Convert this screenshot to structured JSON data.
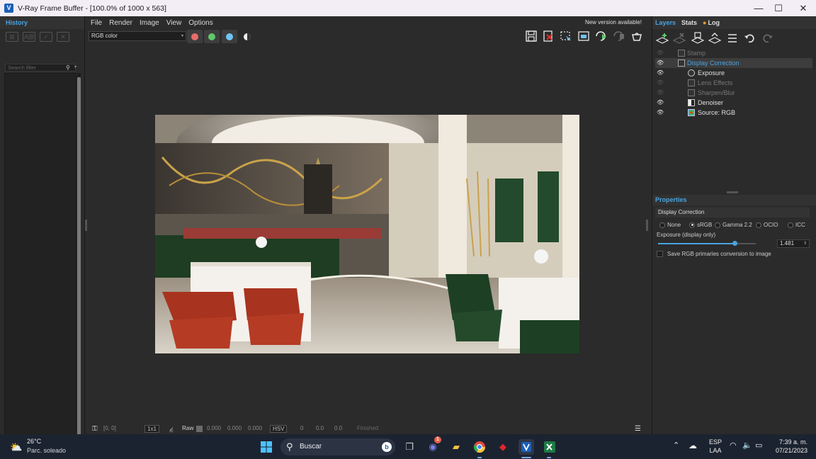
{
  "window": {
    "app_icon": "V",
    "title": "V-Ray Frame Buffer - [100.0% of 1000 x 563]",
    "controls": {
      "minimize": "—",
      "maximize": "☐",
      "close": "✕"
    }
  },
  "history": {
    "header": "History",
    "tools": [
      "⊞",
      "A|B",
      "✓",
      "✕"
    ],
    "search_placeholder": "Search filter",
    "search_icon": "⚲",
    "search_dropdown": "▾"
  },
  "menu": {
    "items": [
      "File",
      "Render",
      "Image",
      "View",
      "Options"
    ],
    "notice": "New version available!"
  },
  "toolbar": {
    "channel": "RGB color",
    "channel_dd": "▾",
    "color_buttons": [
      {
        "name": "red",
        "color": "#e86c6c"
      },
      {
        "name": "green",
        "color": "#5fc86a"
      },
      {
        "name": "blue",
        "color": "#6fc4f0"
      }
    ],
    "right_icons": [
      "🖫",
      "🗙",
      "⬚",
      "▣",
      "⟳",
      "⟳",
      "☕"
    ]
  },
  "status": {
    "coords": "[0, 0]",
    "zoom": "1x1",
    "mode": "Raw",
    "rgb": [
      "0.000",
      "0.000",
      "0.000"
    ],
    "colorspace": "HSV",
    "hsv": [
      "0",
      "0.0",
      "0.0"
    ],
    "state": "Finished"
  },
  "right_panel": {
    "tabs": [
      "Layers",
      "Stats",
      "Log"
    ],
    "log_dot_color": "#f09a30",
    "layers": [
      {
        "label": "Stamp",
        "visible": false,
        "enabled": false
      },
      {
        "label": "Display Correction",
        "visible": true,
        "enabled": true,
        "selected": true
      },
      {
        "label": "Exposure",
        "visible": true,
        "enabled": true
      },
      {
        "label": "Lens Effects",
        "visible": false,
        "enabled": false
      },
      {
        "label": "Sharpen/Blur",
        "visible": false,
        "enabled": false
      },
      {
        "label": "Denoiser",
        "visible": true,
        "enabled": true
      },
      {
        "label": "Source: RGB",
        "visible": true,
        "enabled": true
      }
    ],
    "properties_header": "Properties",
    "properties_title": "Display Correction",
    "radio_options": [
      "None",
      "sRGB",
      "Gamma 2.2",
      "OCIO",
      "ICC"
    ],
    "radio_selected": "sRGB",
    "exposure_label": "Exposure (display only)",
    "exposure_value": "1.481",
    "exposure_level": 0.78,
    "save_rgb_label": "Save RGB primaries conversion to image"
  },
  "taskbar": {
    "weather_temp": "26°C",
    "weather_desc": "Parc. soleado",
    "search_label": "Buscar",
    "teams_badge": "1",
    "lang_top": "ESP",
    "lang_bottom": "LAA",
    "time": "7:39 a. m.",
    "date": "07/21/2023"
  }
}
